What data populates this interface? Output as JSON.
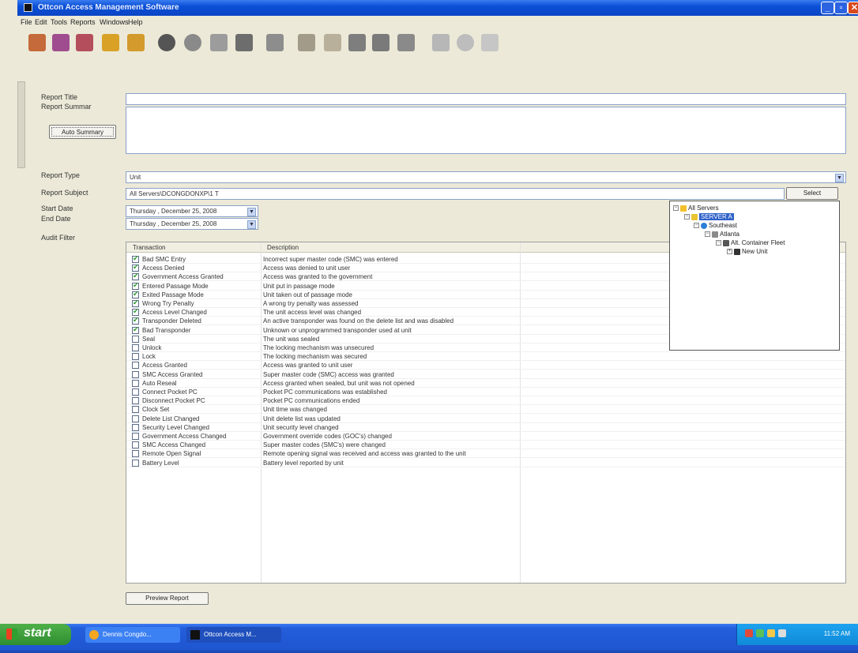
{
  "window": {
    "title": "Ottcon Access Management Software"
  },
  "menu": [
    "File",
    "Edit",
    "Tools",
    "Reports",
    "Windows",
    "Help"
  ],
  "form": {
    "report_title_label": "Report Title",
    "report_summary_label": "Report Summar",
    "auto_summary_button": "Auto Summary",
    "report_type_label": "Report Type",
    "report_type_value": "Unit",
    "report_subject_label": "Report Subject",
    "report_subject_value": "All Servers\\DCONGDONXP\\1 T",
    "select_button": "Select",
    "start_date_label": "Start Date",
    "start_date_value": "Thursday , December 25, 2008",
    "end_date_label": "End Date",
    "end_date_value": "Thursday , December 25, 2008",
    "audit_filter_label": "Audit Filter",
    "preview_button": "Preview Report"
  },
  "grid": {
    "columns": [
      "Transaction",
      "Description"
    ],
    "rows": [
      {
        "checked": true,
        "transaction": "Bad SMC Entry",
        "description": "Incorrect super master code (SMC) was entered"
      },
      {
        "checked": true,
        "transaction": "Access Denied",
        "description": "Access was denied to unit user"
      },
      {
        "checked": true,
        "transaction": "Government Access Granted",
        "description": "Access was granted to the government"
      },
      {
        "checked": true,
        "transaction": "Entered Passage Mode",
        "description": "Unit put in passage mode"
      },
      {
        "checked": true,
        "transaction": "Exited Passage Mode",
        "description": "Unit taken out of passage mode"
      },
      {
        "checked": true,
        "transaction": "Wrong Try Penalty",
        "description": "A wrong try penalty was assessed"
      },
      {
        "checked": true,
        "transaction": "Access Level Changed",
        "description": "The unit access level was changed"
      },
      {
        "checked": true,
        "transaction": "Transponder Deleted",
        "description": "An active transponder was found on the delete list and was disabled"
      },
      {
        "checked": true,
        "transaction": "Bad Transponder",
        "description": "Unknown or unprogrammed transponder used at unit"
      },
      {
        "checked": false,
        "transaction": "Seal",
        "description": "The unit was sealed"
      },
      {
        "checked": false,
        "transaction": "Unlock",
        "description": "The locking mechanism was unsecured"
      },
      {
        "checked": false,
        "transaction": "Lock",
        "description": "The locking mechanism was secured"
      },
      {
        "checked": false,
        "transaction": "Access Granted",
        "description": "Access was granted to unit user"
      },
      {
        "checked": false,
        "transaction": "SMC Access Granted",
        "description": "Super master code (SMC) access was granted"
      },
      {
        "checked": false,
        "transaction": "Auto Reseal",
        "description": "Access granted when sealed, but unit was not opened"
      },
      {
        "checked": false,
        "transaction": "Connect Pocket PC",
        "description": "Pocket PC communications was established"
      },
      {
        "checked": false,
        "transaction": "Disconnect Pocket PC",
        "description": "Pocket PC communications ended"
      },
      {
        "checked": false,
        "transaction": "Clock Set",
        "description": "Unit time was changed"
      },
      {
        "checked": false,
        "transaction": "Delete List Changed",
        "description": "Unit delete list was updated"
      },
      {
        "checked": false,
        "transaction": "Security Level Changed",
        "description": "Unit security level changed"
      },
      {
        "checked": false,
        "transaction": "Government Access Changed",
        "description": "Government override codes (GOC's) changed"
      },
      {
        "checked": false,
        "transaction": "SMC Access Changed",
        "description": "Super master codes (SMC's) were changed"
      },
      {
        "checked": false,
        "transaction": "Remote Open Signal",
        "description": "Remote opening signal was received and access was granted to the unit"
      },
      {
        "checked": false,
        "transaction": "Battery Level",
        "description": "Battery level reported by unit"
      }
    ]
  },
  "tree": {
    "root": "All Servers",
    "server": "SERVER A",
    "region": "Southeast",
    "site": "Atlanta",
    "fleet": "Alt. Container Fleet",
    "unit": "New Unit"
  },
  "taskbar": {
    "start": "start",
    "tasks": [
      "Dennis Congdo...",
      "Ottcon Access M..."
    ],
    "clock": "11:52 AM"
  },
  "colors": {
    "title_bar": "#0a4fd6",
    "taskbar": "#245edb",
    "start_button": "#3a9e38",
    "close_button": "#d9491d",
    "selection": "#2e61c9"
  }
}
